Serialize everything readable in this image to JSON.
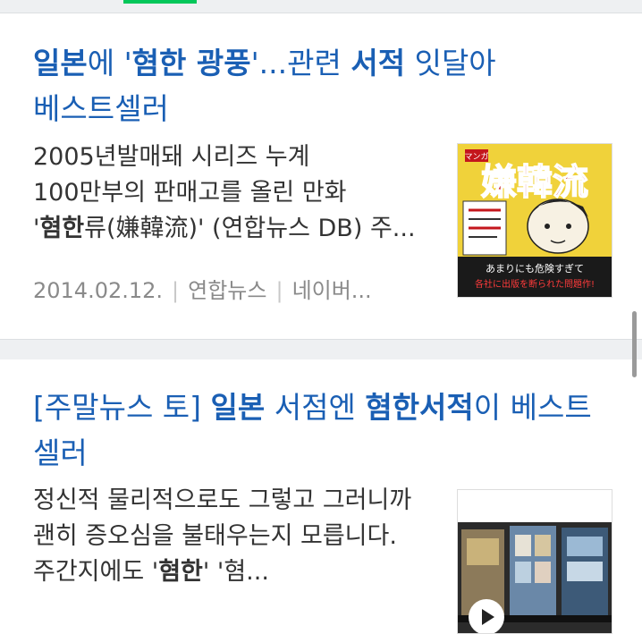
{
  "articles": [
    {
      "title_parts": [
        "일본",
        "에 '",
        "혐한 광풍",
        "'...관련 ",
        "서적",
        " 잇달아 베스트셀러"
      ],
      "snippet_parts": [
        "2005년발매돼 시리즈 누계 100만부의 판매고를 올린 만화 '",
        "혐한",
        "류(嫌韓流)' (연합뉴스 DB) 주..."
      ],
      "date": "2014.02.12.",
      "source": "연합뉴스",
      "portal": "네이버...",
      "thumbnail": {
        "banner": "マンガ",
        "title_text": "嫌韓流",
        "caption_line1": "あまりにも危険すぎて",
        "caption_line2": "各社に出版を断られた問題作!",
        "colors": {
          "bg": "#f0d23a",
          "title": "#c4161c",
          "band": "#1a1a1a"
        }
      }
    },
    {
      "title_parts": [
        "[주말뉴스 토] ",
        "일본",
        " 서점엔 ",
        "혐한서적",
        "이 베스트 셀러"
      ],
      "snippet_parts": [
        "정신적 물리적으로도 그렇고 그러니까 괜히 증오심을 불태우는지 모릅니다. 주간지에도 '",
        "혐한",
        "' '혐..."
      ],
      "thumbnail": {
        "has_play_icon": true
      }
    }
  ],
  "colors": {
    "title": "#1a5fb4",
    "accent_green": "#03c75a",
    "separator": "#eef0f2"
  }
}
